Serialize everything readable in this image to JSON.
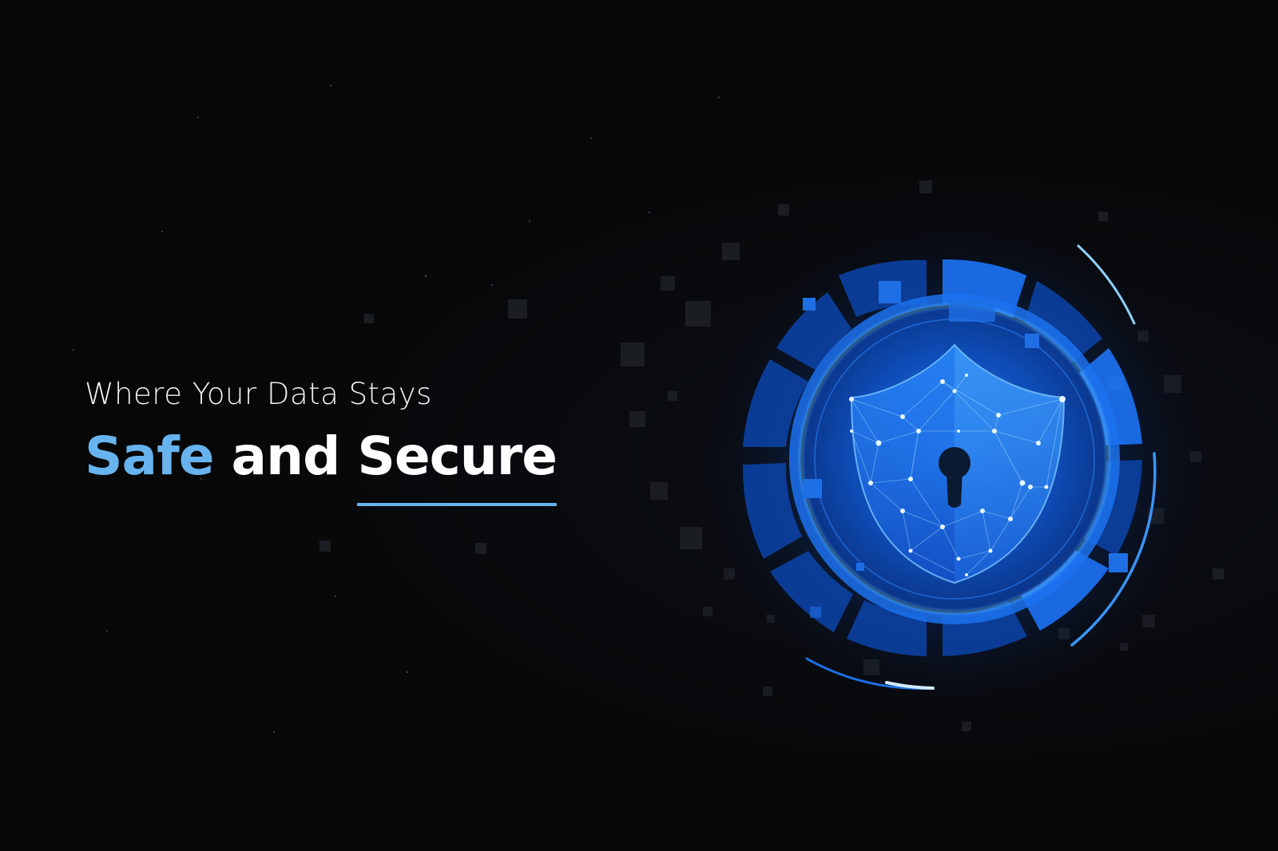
{
  "headline": {
    "line1": "Where Your Data Stays",
    "word_safe": "Safe",
    "word_and": "and",
    "word_secure": "Secure"
  },
  "colors": {
    "background": "#070707",
    "accent": "#66b3ee",
    "text": "#ffffff",
    "glow": "#1e7bff"
  },
  "graphic": {
    "icon": "shield-keyhole-icon",
    "description_icon": "padlock-shield"
  }
}
